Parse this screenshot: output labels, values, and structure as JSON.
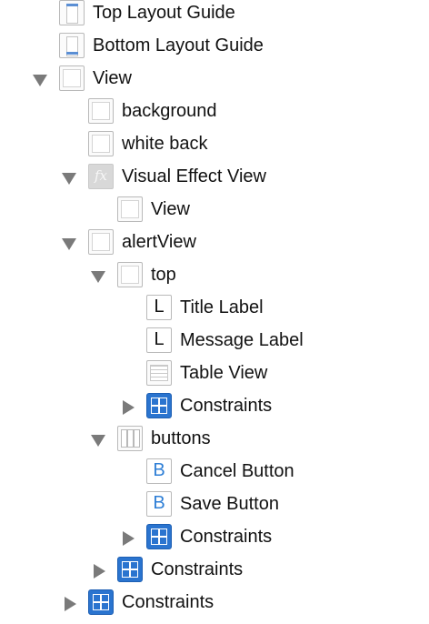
{
  "outline": {
    "rows": [
      {
        "label": "Top Layout Guide",
        "icon": "layout-guide-top-icon"
      },
      {
        "label": "Bottom Layout Guide",
        "icon": "layout-guide-bottom-icon"
      },
      {
        "label": "View",
        "icon": "view-icon",
        "disclosure": "expanded"
      },
      {
        "label": "background",
        "icon": "view-icon"
      },
      {
        "label": "white back",
        "icon": "view-icon"
      },
      {
        "label": "Visual Effect View",
        "icon": "visual-effect-fx-icon",
        "disclosure": "expanded",
        "icon_text": "fx"
      },
      {
        "label": "View",
        "icon": "view-icon"
      },
      {
        "label": "alertView",
        "icon": "view-icon",
        "disclosure": "expanded"
      },
      {
        "label": "top",
        "icon": "view-icon",
        "disclosure": "expanded"
      },
      {
        "label": "Title Label",
        "icon": "label-icon",
        "icon_text": "L"
      },
      {
        "label": "Message Label",
        "icon": "label-icon",
        "icon_text": "L"
      },
      {
        "label": "Table View",
        "icon": "table-view-icon"
      },
      {
        "label": "Constraints",
        "icon": "constraints-icon",
        "disclosure": "collapsed"
      },
      {
        "label": "buttons",
        "icon": "stack-view-icon",
        "disclosure": "expanded"
      },
      {
        "label": "Cancel Button",
        "icon": "button-icon",
        "icon_text": "B"
      },
      {
        "label": "Save Button",
        "icon": "button-icon",
        "icon_text": "B"
      },
      {
        "label": "Constraints",
        "icon": "constraints-icon",
        "disclosure": "collapsed"
      },
      {
        "label": "Constraints",
        "icon": "constraints-icon",
        "disclosure": "collapsed"
      },
      {
        "label": "Constraints",
        "icon": "constraints-icon",
        "disclosure": "collapsed"
      }
    ]
  },
  "colors": {
    "disclosure_triangle": "#7a7a7a",
    "constraints_blue": "#2a74cf",
    "button_glyph_blue": "#2f7fd6",
    "layout_guide_bar": "#5b8fd4"
  }
}
